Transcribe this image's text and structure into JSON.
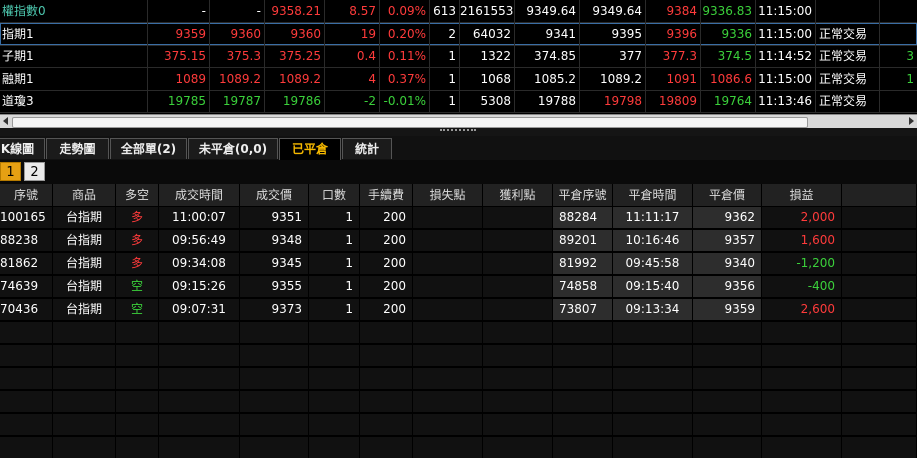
{
  "quote_rows": [
    {
      "name": "權指數0",
      "name_color": "#4ec9b0",
      "cells": [
        "-",
        "-",
        "9358.21",
        "8.57",
        "0.09%",
        "613",
        "2161553",
        "9349.64",
        "9349.64",
        "9384",
        "9336.83",
        "11:15:00",
        ""
      ],
      "colors": [
        "#ffffff",
        "#ffffff",
        "#ff3b3b",
        "#ff3b3b",
        "#ff3b3b",
        "#ffffff",
        "#ffffff",
        "#ffffff",
        "#ffffff",
        "#ff3b3b",
        "#3bd13b",
        "#ffffff",
        "#ffffff"
      ],
      "extra": ""
    },
    {
      "name": "指期1",
      "name_color": "#ffffff",
      "cells": [
        "9359",
        "9360",
        "9360",
        "19",
        "0.20%",
        "2",
        "64032",
        "9341",
        "9395",
        "9396",
        "9336",
        "11:15:00",
        "正常交易"
      ],
      "colors": [
        "#ff3b3b",
        "#ff3b3b",
        "#ff3b3b",
        "#ff3b3b",
        "#ff3b3b",
        "#ffffff",
        "#ffffff",
        "#ffffff",
        "#ffffff",
        "#ff3b3b",
        "#3bd13b",
        "#ffffff",
        "#ffffff"
      ],
      "extra": ""
    },
    {
      "name": "子期1",
      "name_color": "#ffffff",
      "cells": [
        "375.15",
        "375.3",
        "375.25",
        "0.4",
        "0.11%",
        "1",
        "1322",
        "374.85",
        "377",
        "377.3",
        "374.5",
        "11:14:52",
        "正常交易"
      ],
      "colors": [
        "#ff3b3b",
        "#ff3b3b",
        "#ff3b3b",
        "#ff3b3b",
        "#ff3b3b",
        "#ffffff",
        "#ffffff",
        "#ffffff",
        "#ffffff",
        "#ff3b3b",
        "#3bd13b",
        "#ffffff",
        "#ffffff"
      ],
      "extra": "3"
    },
    {
      "name": "融期1",
      "name_color": "#ffffff",
      "cells": [
        "1089",
        "1089.2",
        "1089.2",
        "4",
        "0.37%",
        "1",
        "1068",
        "1085.2",
        "1089.2",
        "1091",
        "1086.6",
        "11:15:00",
        "正常交易"
      ],
      "colors": [
        "#ff3b3b",
        "#ff3b3b",
        "#ff3b3b",
        "#ff3b3b",
        "#ff3b3b",
        "#ffffff",
        "#ffffff",
        "#ffffff",
        "#ffffff",
        "#ff3b3b",
        "#ff3b3b",
        "#ffffff",
        "#ffffff"
      ],
      "extra": "1"
    },
    {
      "name": "道瓊3",
      "name_color": "#ffffff",
      "cells": [
        "19785",
        "19787",
        "19786",
        "-2",
        "-0.01%",
        "1",
        "5308",
        "19788",
        "19798",
        "19809",
        "19764",
        "11:13:46",
        "正常交易"
      ],
      "colors": [
        "#3bd13b",
        "#3bd13b",
        "#3bd13b",
        "#3bd13b",
        "#3bd13b",
        "#ffffff",
        "#ffffff",
        "#ffffff",
        "#ff3b3b",
        "#ff3b3b",
        "#3bd13b",
        "#ffffff",
        "#ffffff"
      ],
      "extra": ""
    }
  ],
  "tabs": [
    {
      "label": "K線圖",
      "active": false
    },
    {
      "label": "走勢圖",
      "active": false
    },
    {
      "label": "全部單(2)",
      "active": false
    },
    {
      "label": "未平倉(0,0)",
      "active": false
    },
    {
      "label": "已平倉",
      "active": true
    },
    {
      "label": "統計",
      "active": false
    }
  ],
  "pager": {
    "page1": "1",
    "page2": "2"
  },
  "grid": {
    "headers": [
      "序號",
      "商品",
      "多空",
      "成交時間",
      "成交價",
      "口數",
      "手續費",
      "損失點",
      "獲利點",
      "平倉序號",
      "平倉時間",
      "平倉價",
      "損益"
    ],
    "rows": [
      {
        "cells": [
          "100165",
          "台指期",
          "多",
          "11:00:07",
          "9351",
          "1",
          "200",
          "",
          "",
          "88284",
          "11:11:17",
          "9362",
          "2,000"
        ],
        "side_color": "#ff3b3b",
        "pl_color": "#ff3b3b"
      },
      {
        "cells": [
          "88238",
          "台指期",
          "多",
          "09:56:49",
          "9348",
          "1",
          "200",
          "",
          "",
          "89201",
          "10:16:46",
          "9357",
          "1,600"
        ],
        "side_color": "#ff3b3b",
        "pl_color": "#ff3b3b"
      },
      {
        "cells": [
          "81862",
          "台指期",
          "多",
          "09:34:08",
          "9345",
          "1",
          "200",
          "",
          "",
          "81992",
          "09:45:58",
          "9340",
          "-1,200"
        ],
        "side_color": "#ff3b3b",
        "pl_color": "#3bd13b"
      },
      {
        "cells": [
          "74639",
          "台指期",
          "空",
          "09:15:26",
          "9355",
          "1",
          "200",
          "",
          "",
          "74858",
          "09:15:40",
          "9356",
          "-400"
        ],
        "side_color": "#3bd13b",
        "pl_color": "#3bd13b"
      },
      {
        "cells": [
          "70436",
          "台指期",
          "空",
          "09:07:31",
          "9373",
          "1",
          "200",
          "",
          "",
          "73807",
          "09:13:34",
          "9359",
          "2,600"
        ],
        "side_color": "#3bd13b",
        "pl_color": "#ff3b3b"
      }
    ]
  }
}
